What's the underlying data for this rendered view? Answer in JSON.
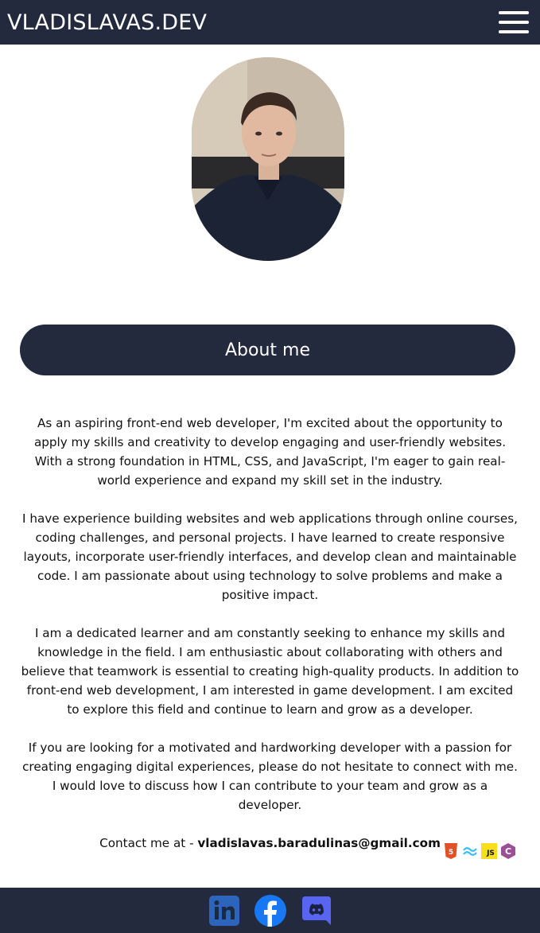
{
  "header": {
    "brand": "VLADISLAVAS.DEV",
    "menu_icon": "hamburger-icon"
  },
  "profile": {
    "photo": "profile-photo"
  },
  "about": {
    "button_label": "About me",
    "paragraphs": [
      "As an aspiring front-end web developer, I'm excited about the opportunity to apply my skills and creativity to develop engaging and user-friendly websites. With a strong foundation in HTML, CSS, and JavaScript, I'm eager to gain real-world experience and expand my skill set in the industry.",
      "I have experience building websites and web applications through online courses, coding challenges, and personal projects. I have learned to create responsive layouts, incorporate user-friendly interfaces, and develop clean and maintainable code. I am passionate about using technology to solve problems and make a positive impact.",
      "I am a dedicated learner and am constantly seeking to enhance my skills and knowledge in the field. I am enthusiastic about collaborating with others and believe that teamwork is essential to creating high-quality products. In addition to front-end web development, I am interested in game development. I am excited to explore this field and continue to learn and grow as a developer.",
      "If you are looking for a motivated and hardworking developer with a passion for creating engaging digital experiences, please do not hesitate to connect with me. I would love to discuss how I can contribute to your team and grow as a developer."
    ],
    "contact_prefix": "Contact me at - ",
    "contact_email": "vladislavas.baradulinas@gmail.com"
  },
  "tech_icons": [
    {
      "name": "html5-icon",
      "label": "5",
      "color": "#e34f26"
    },
    {
      "name": "tailwind-icon",
      "label": "≈",
      "color": "#38bdf8"
    },
    {
      "name": "javascript-icon",
      "label": "JS",
      "color": "#f7df1e"
    },
    {
      "name": "csharp-icon",
      "label": "C",
      "color": "#9b4f96"
    }
  ],
  "footer": {
    "social": [
      {
        "name": "linkedin-icon",
        "color": "#2d64bc"
      },
      {
        "name": "facebook-icon",
        "color": "#1877f2"
      },
      {
        "name": "discord-icon",
        "color": "#5865f2"
      }
    ]
  },
  "colors": {
    "navy": "#232a3e",
    "background": "#ffffff"
  }
}
